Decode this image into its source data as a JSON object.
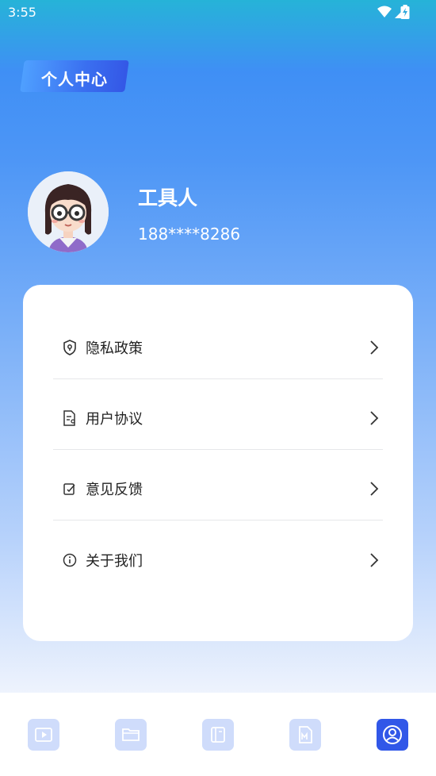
{
  "status_bar": {
    "time": "3:55"
  },
  "header": {
    "title": "个人中心"
  },
  "profile": {
    "name": "工具人",
    "phone": "188****8286"
  },
  "menu": [
    {
      "label": "隐私政策",
      "icon": "shield-lock-icon"
    },
    {
      "label": "用户协议",
      "icon": "agreement-document-icon"
    },
    {
      "label": "意见反馈",
      "icon": "feedback-edit-icon"
    },
    {
      "label": "关于我们",
      "icon": "info-circle-icon"
    }
  ],
  "tabs": [
    {
      "icon": "video-play-icon",
      "active": false
    },
    {
      "icon": "folder-icon",
      "active": false
    },
    {
      "icon": "notebook-icon",
      "active": false
    },
    {
      "icon": "markdown-file-icon",
      "active": false
    },
    {
      "icon": "user-profile-icon",
      "active": true
    }
  ],
  "colors": {
    "accent": "#3157e8",
    "tab_inactive": "#cfdcfb",
    "gradient_top": "#26b3d8",
    "gradient_mid": "#4d96f6"
  }
}
